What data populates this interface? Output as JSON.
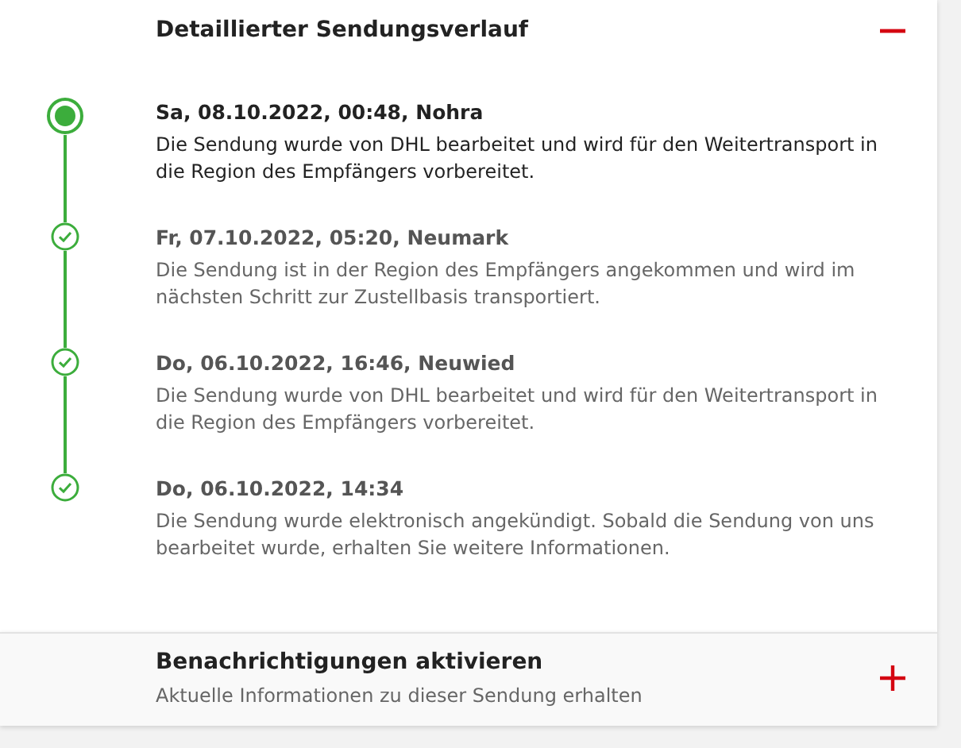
{
  "history": {
    "title": "Detaillierter Sendungsverlauf",
    "expanded": true,
    "events": [
      {
        "kind": "current",
        "heading": "Sa, 08.10.2022, 00:48, Nohra",
        "text": "Die Sendung wurde von DHL bearbeitet und wird für den Weitertransport in die Region des Empfängers vorbereitet."
      },
      {
        "kind": "done",
        "heading": "Fr, 07.10.2022, 05:20, Neumark",
        "text": "Die Sendung ist in der Region des Empfängers angekommen und wird im nächsten Schritt zur Zustellbasis transportiert."
      },
      {
        "kind": "done",
        "heading": "Do, 06.10.2022, 16:46, Neuwied",
        "text": "Die Sendung wurde von DHL bearbeitet und wird für den Weitertransport in die Region des Empfängers vorbereitet."
      },
      {
        "kind": "done",
        "heading": "Do, 06.10.2022, 14:34",
        "text": "Die Sendung wurde elektronisch angekündigt. Sobald die Sendung von uns bearbeitet wurde, erhalten Sie weitere Informationen."
      }
    ]
  },
  "notifications": {
    "title": "Benachrichtigungen aktivieren",
    "subtitle": "Aktuelle Informationen zu dieser Sendung erhalten",
    "expanded": false
  }
}
